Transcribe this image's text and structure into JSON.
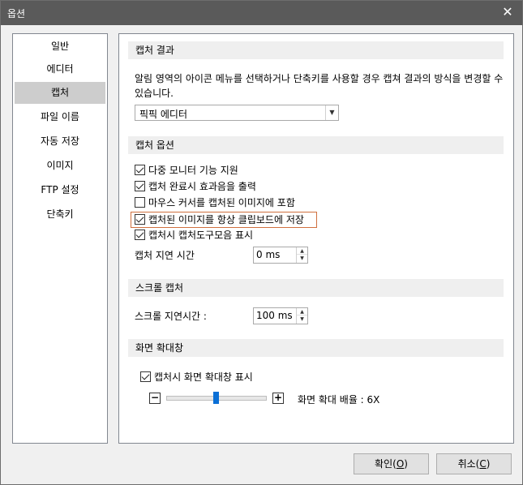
{
  "window": {
    "title": "옵션"
  },
  "sidebar": {
    "items": [
      {
        "label": "일반",
        "selected": false
      },
      {
        "label": "에디터",
        "selected": false
      },
      {
        "label": "캡처",
        "selected": true
      },
      {
        "label": "파일 이름",
        "selected": false
      },
      {
        "label": "자동 저장",
        "selected": false
      },
      {
        "label": "이미지",
        "selected": false
      },
      {
        "label": "FTP 설정",
        "selected": false
      },
      {
        "label": "단축키",
        "selected": false
      }
    ]
  },
  "capture_result": {
    "header": "캡처 결과",
    "description": "알림 영역의 아이콘 메뉴를 선택하거나 단축키를 사용할 경우 캡쳐 결과의 방식을 변경할 수 있습니다.",
    "selected": "픽픽 에디터"
  },
  "capture_options": {
    "header": "캡처 옵션",
    "checkboxes": [
      {
        "label": "다중 모니터 기능 지원",
        "checked": true
      },
      {
        "label": "캡처 완료시 효과음을 출력",
        "checked": true
      },
      {
        "label": "마우스 커서를 캡처된 이미지에 포함",
        "checked": false
      },
      {
        "label": "캡처된 이미지를 항상 클립보드에 저장",
        "checked": true
      },
      {
        "label": "캡처시 캡처도구모음 표시",
        "checked": true
      }
    ],
    "delay_label": "캡처 지연 시간",
    "delay_value": "0 ms"
  },
  "scroll_capture": {
    "header": "스크롤 캡처",
    "delay_label": "스크롤 지연시간 :",
    "delay_value": "100 ms"
  },
  "magnifier": {
    "header": "화면 확대창",
    "checkbox_label": "캡처시 화면 확대창 표시",
    "checkbox_checked": true,
    "zoom_text": "화면 확대 배율 : 6X",
    "slider_fraction": 0.47
  },
  "footer": {
    "ok_label": "확인(",
    "ok_key": "O",
    "ok_end": ")",
    "cancel_label": "취소(",
    "cancel_key": "C",
    "cancel_end": ")"
  }
}
